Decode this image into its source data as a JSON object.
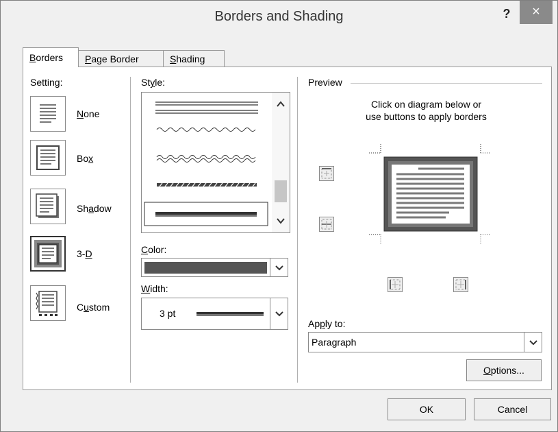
{
  "window": {
    "title": "Borders and Shading",
    "help_label": "?",
    "close_label": "×"
  },
  "tabs": [
    {
      "label": "Borders",
      "key": "B",
      "rest": "orders"
    },
    {
      "label": "Page Border",
      "key": "P",
      "rest": "age Border"
    },
    {
      "label": "Shading",
      "key": "S",
      "rest": "hading"
    }
  ],
  "setting": {
    "heading": "Setting:",
    "options": [
      {
        "pre": "",
        "key": "N",
        "post": "one"
      },
      {
        "pre": "Bo",
        "key": "x",
        "post": ""
      },
      {
        "pre": "Sh",
        "key": "a",
        "post": "dow"
      },
      {
        "pre": "3-",
        "key": "D",
        "post": ""
      },
      {
        "pre": "C",
        "key": "u",
        "post": "stom"
      }
    ]
  },
  "style": {
    "pre": "St",
    "key": "y",
    "post": "le:"
  },
  "color": {
    "pre": "",
    "key": "C",
    "post": "olor:"
  },
  "width": {
    "pre": "",
    "key": "W",
    "post": "idth:",
    "value": "3 pt"
  },
  "preview": {
    "heading": "Preview",
    "instruction_line1": "Click on diagram below or",
    "instruction_line2": "use buttons to apply borders"
  },
  "apply_to": {
    "pre": "Ap",
    "key": "p",
    "post": "ly to:",
    "value": "Paragraph"
  },
  "buttons": {
    "options": {
      "pre": "",
      "key": "O",
      "post": "ptions..."
    },
    "ok": "OK",
    "cancel": "Cancel"
  },
  "colors": {
    "border": "#555555",
    "close_bg": "#8a8a8a"
  }
}
